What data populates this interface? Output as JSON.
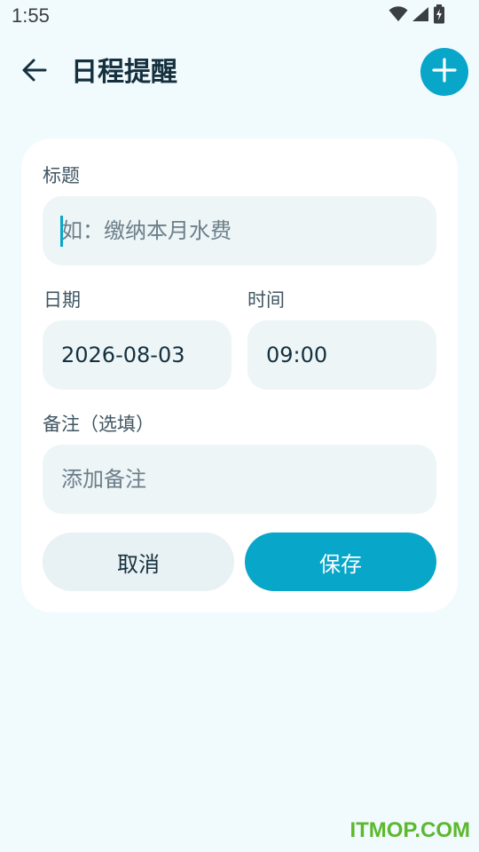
{
  "status_bar": {
    "time": "1:55",
    "icons": [
      "wifi-icon",
      "signal-icon",
      "battery-icon"
    ]
  },
  "app_bar": {
    "title": "日程提醒",
    "back_icon": "arrow-left-icon",
    "add_icon": "plus-icon"
  },
  "form": {
    "title_label": "标题",
    "title_placeholder": "如：缴纳本月水费",
    "date_label": "日期",
    "date_value": "2026-08-03",
    "time_label": "时间",
    "time_value": "09:00",
    "note_label": "备注（选填）",
    "note_placeholder": "添加备注",
    "cancel_label": "取消",
    "save_label": "保存"
  },
  "watermark": "ITMOP.COM",
  "colors": {
    "accent": "#08a6c9",
    "background": "#f1fafc",
    "field": "#edf5f7",
    "watermark": "#5cb82e"
  }
}
